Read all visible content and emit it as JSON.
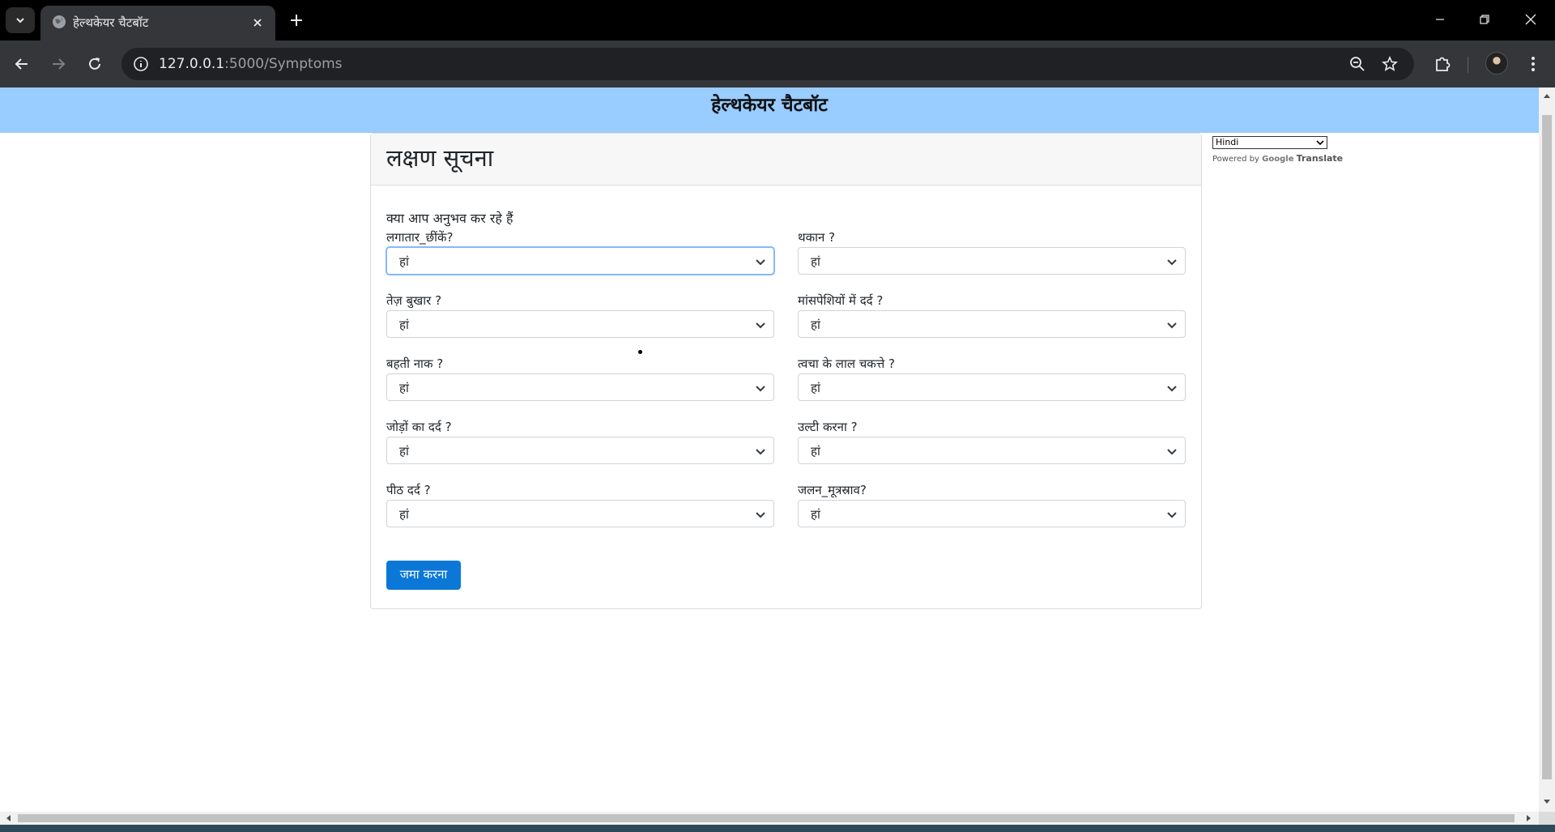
{
  "browser": {
    "tab_title": "हेल्थकेयर चैटबॉट",
    "url_host": "127.0.0.1",
    "url_path": ":5000/Symptoms"
  },
  "page": {
    "header_title": "हेल्थकेयर चैटबॉट",
    "card_title": "लक्षण सूचना",
    "intro": "क्या आप अनुभव कर रहे हैं",
    "fields": [
      {
        "label": "लगातार_छींकें?",
        "value": "हां"
      },
      {
        "label": "थकान ?",
        "value": "हां"
      },
      {
        "label": "तेज़ बुखार ?",
        "value": "हां"
      },
      {
        "label": "मांसपेशियों में दर्द ?",
        "value": "हां"
      },
      {
        "label": "बहती नाक ?",
        "value": "हां"
      },
      {
        "label": "त्वचा के लाल चकत्ते ?",
        "value": "हां"
      },
      {
        "label": "जोड़ों का दर्द ?",
        "value": "हां"
      },
      {
        "label": "उल्टी करना ?",
        "value": "हां"
      },
      {
        "label": "पीठ दर्द ?",
        "value": "हां"
      },
      {
        "label": "जलन_मूत्रस्राव?",
        "value": "हां"
      }
    ],
    "submit_label": "जमा करना"
  },
  "translate": {
    "language": "Hindi",
    "powered_by": "Powered by",
    "google": "Google",
    "translate": "Translate"
  },
  "colors": {
    "header_bg": "#99ccff",
    "button_bg": "#0b78d8"
  }
}
